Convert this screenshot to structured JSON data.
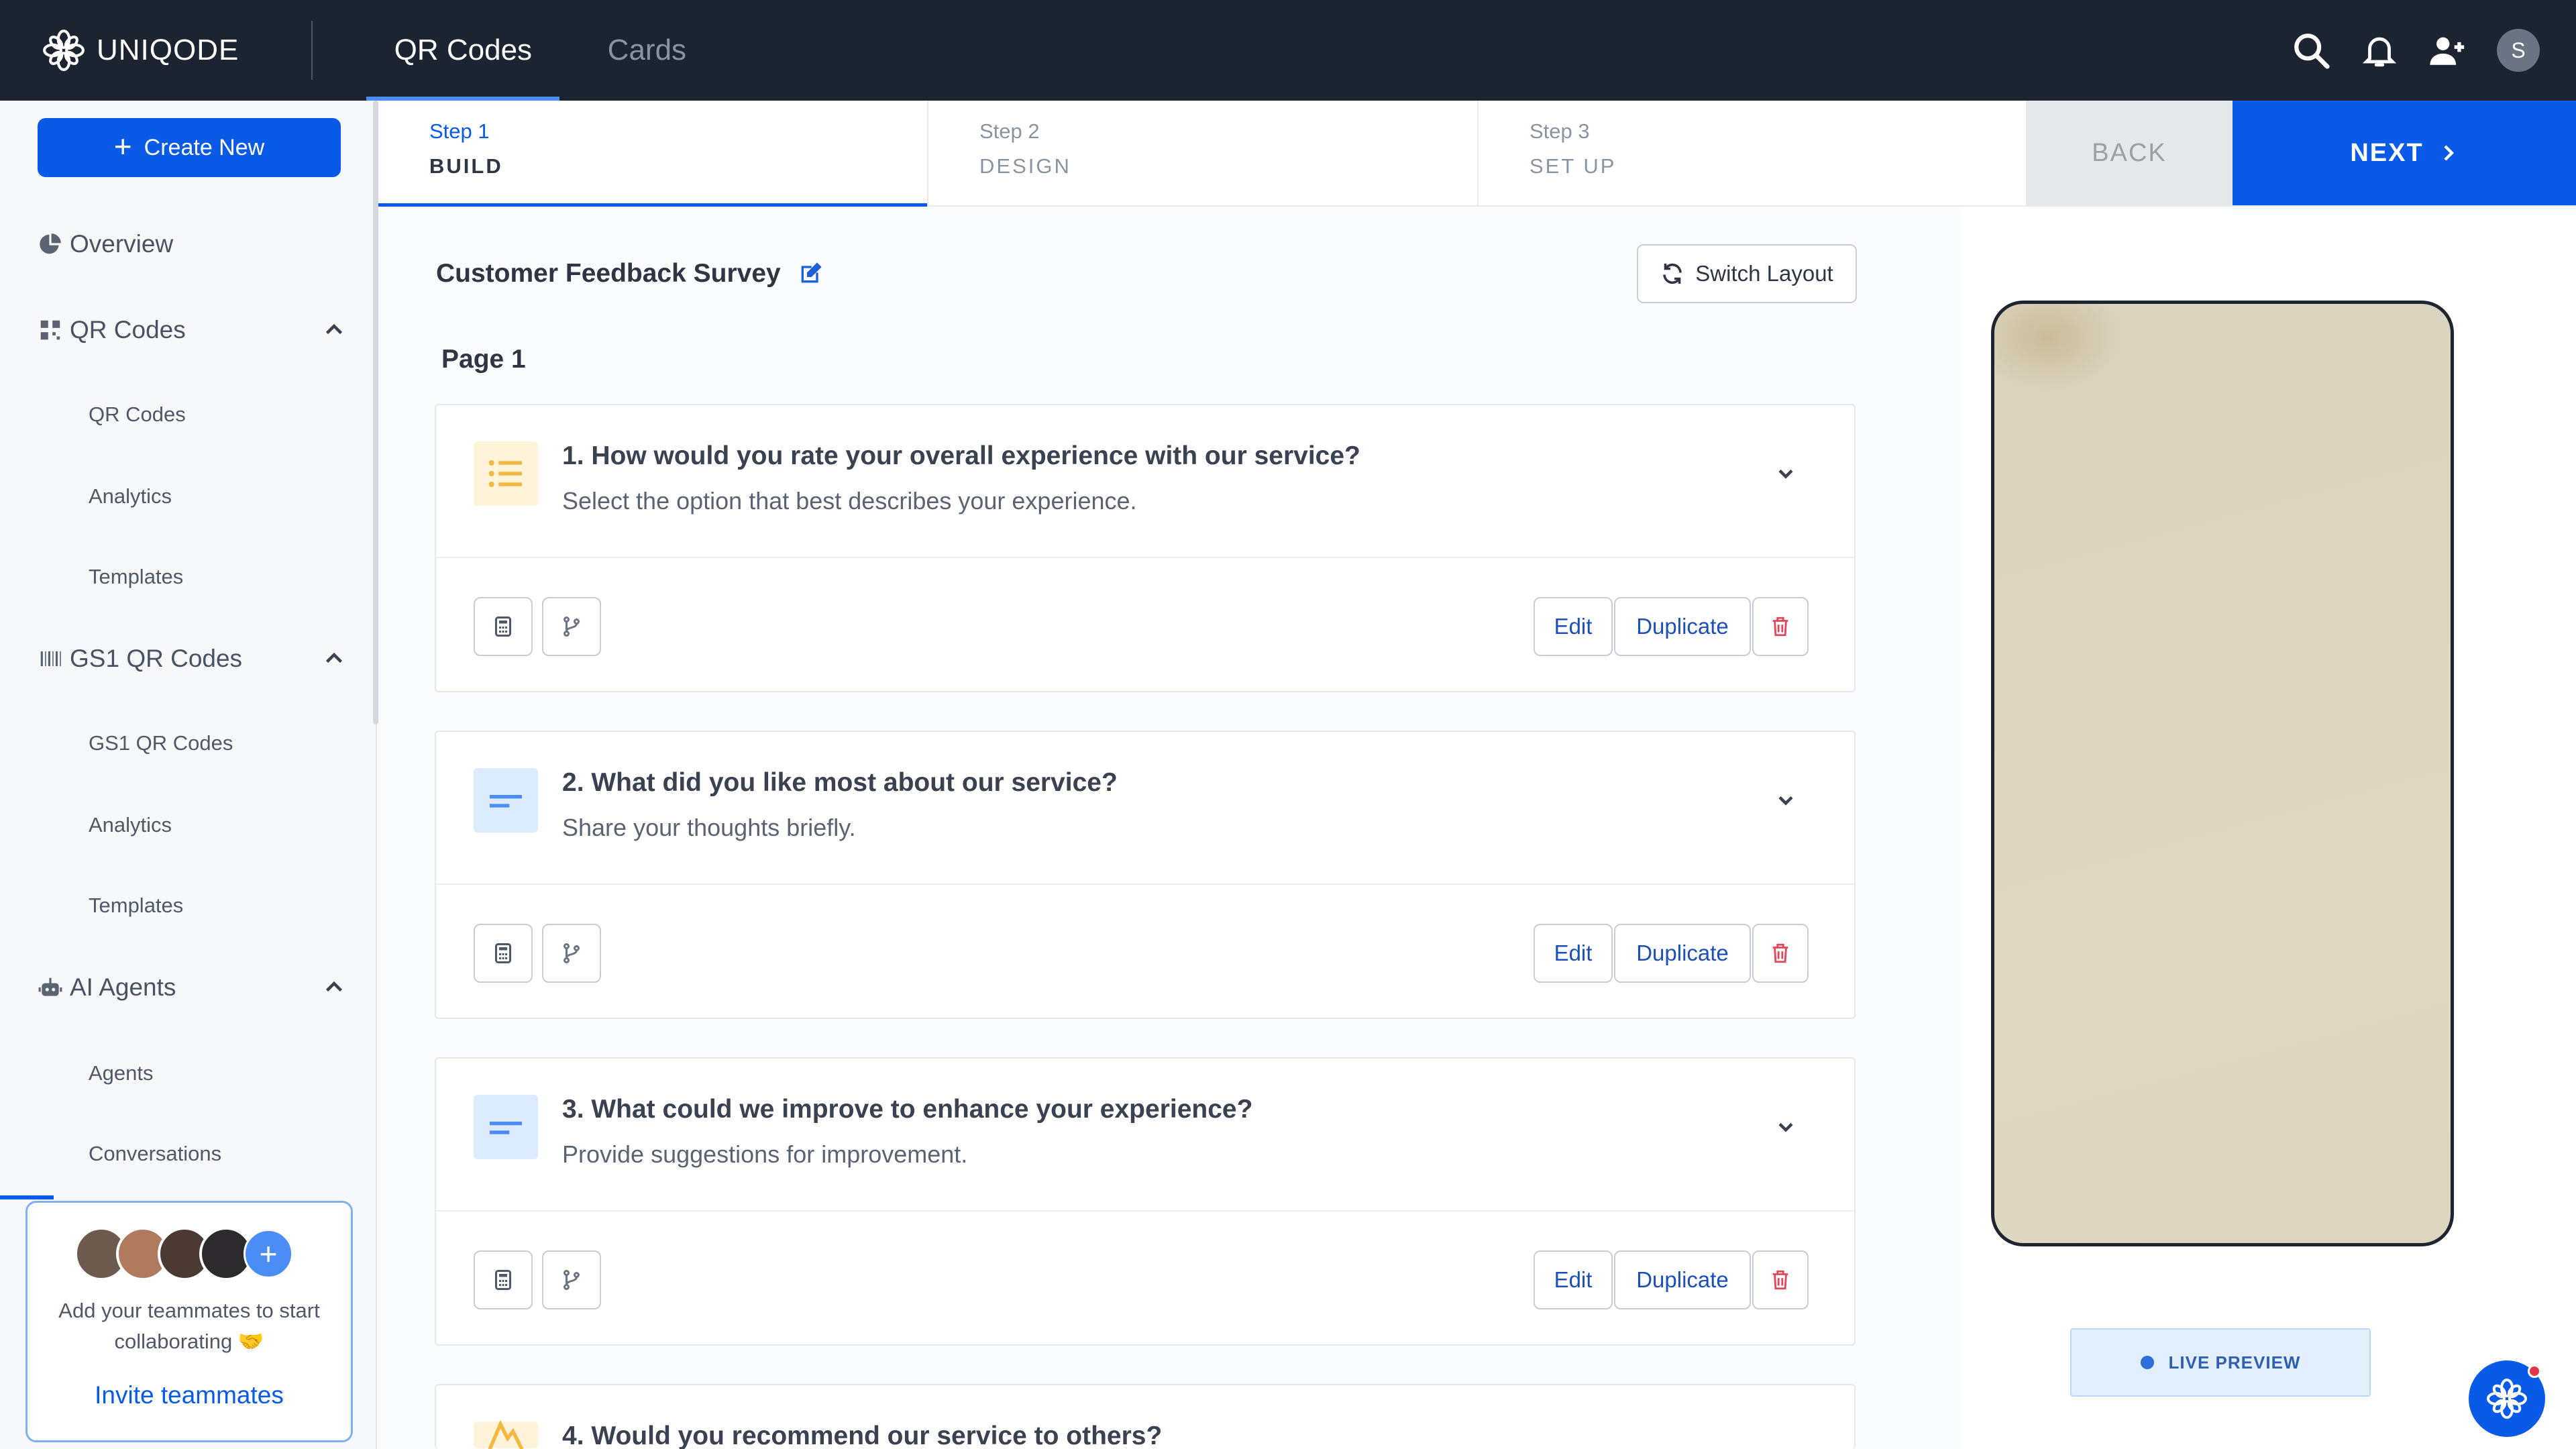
{
  "brand": {
    "name": "UNIQODE"
  },
  "top_tabs": [
    {
      "label": "QR Codes",
      "active": true
    },
    {
      "label": "Cards",
      "active": false
    }
  ],
  "top_icons": [
    "search-icon",
    "bell-icon",
    "add-user-icon"
  ],
  "user_avatar": {
    "initial": "S"
  },
  "sidebar": {
    "create_label": "Create New",
    "overview": "Overview",
    "sections": [
      {
        "label": "QR Codes",
        "icon": "qr-grid-icon",
        "items": [
          "QR Codes",
          "Analytics",
          "Templates"
        ]
      },
      {
        "label": "GS1 QR Codes",
        "icon": "barcode-icon",
        "items": [
          "GS1 QR Codes",
          "Analytics",
          "Templates"
        ]
      },
      {
        "label": "AI Agents",
        "icon": "robot-icon",
        "items": [
          "Agents",
          "Conversations"
        ]
      }
    ],
    "team_card": {
      "text": "Add your teammates to start collaborating 🤝",
      "invite_label": "Invite teammates"
    }
  },
  "steps": [
    {
      "num": "Step 1",
      "name": "BUILD",
      "active": true
    },
    {
      "num": "Step 2",
      "name": "DESIGN",
      "active": false
    },
    {
      "num": "Step 3",
      "name": "SET UP",
      "active": false
    }
  ],
  "nav": {
    "back": "BACK",
    "next": "NEXT"
  },
  "survey": {
    "title": "Customer Feedback Survey",
    "switch_layout": "Switch Layout",
    "page_label": "Page 1",
    "questions": [
      {
        "title": "1. How would you rate your overall experience with our service?",
        "subtitle": "Select the option that best describes your experience.",
        "icon": "list-icon",
        "color": "#f4b740"
      },
      {
        "title": "2. What did you like most about our service?",
        "subtitle": "Share your thoughts briefly.",
        "icon": "short-text-icon",
        "color": "#4b8cf5"
      },
      {
        "title": "3. What could we improve to enhance your experience?",
        "subtitle": "Provide suggestions for improvement.",
        "icon": "short-text-icon",
        "color": "#4b8cf5"
      },
      {
        "title": "4. Would you recommend our service to others?",
        "subtitle": "",
        "icon": "thumb-icon",
        "color": "#f4b740"
      }
    ],
    "actions": {
      "edit": "Edit",
      "duplicate": "Duplicate"
    }
  },
  "preview": {
    "live_label": "LIVE PREVIEW"
  },
  "colors": {
    "primary": "#0a5ae8",
    "topbar": "#1b2430",
    "delete": "#e0475a"
  }
}
